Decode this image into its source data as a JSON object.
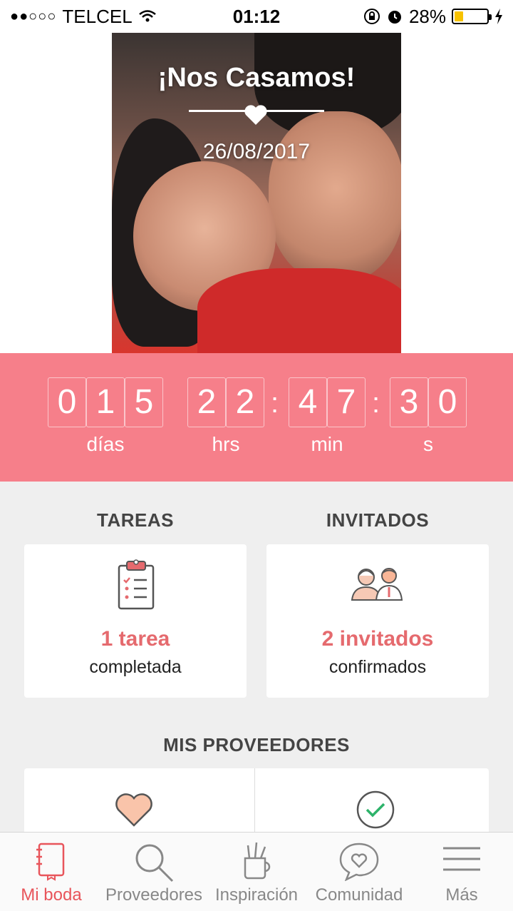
{
  "status_bar": {
    "carrier": "TELCEL",
    "signal": "●●○○○",
    "time": "01:12",
    "battery": "28%",
    "battery_level": 0.28
  },
  "hero": {
    "title": "¡Nos Casamos!",
    "date": "26/08/2017"
  },
  "countdown": {
    "days": [
      "0",
      "1",
      "5"
    ],
    "hours": [
      "2",
      "2"
    ],
    "minutes": [
      "4",
      "7"
    ],
    "seconds": [
      "3",
      "0"
    ],
    "labels": {
      "days": "días",
      "hours": "hrs",
      "minutes": "min",
      "seconds": "s"
    }
  },
  "tareas": {
    "heading": "TAREAS",
    "count": "1 tarea",
    "status": "completada"
  },
  "invitados": {
    "heading": "INVITADOS",
    "count": "2 invitados",
    "status": "confirmados"
  },
  "proveedores": {
    "heading": "MIS PROVEEDORES"
  },
  "tabs": [
    {
      "label": "Mi boda",
      "icon": "notebook-icon",
      "active": true
    },
    {
      "label": "Proveedores",
      "icon": "search-icon",
      "active": false
    },
    {
      "label": "Inspiración",
      "icon": "pencil-cup-icon",
      "active": false
    },
    {
      "label": "Comunidad",
      "icon": "chat-heart-icon",
      "active": false
    },
    {
      "label": "Más",
      "icon": "menu-icon",
      "active": false
    }
  ],
  "colors": {
    "accent": "#f67f8a",
    "accent_text": "#e56a6e",
    "active_tab": "#e8555b"
  }
}
